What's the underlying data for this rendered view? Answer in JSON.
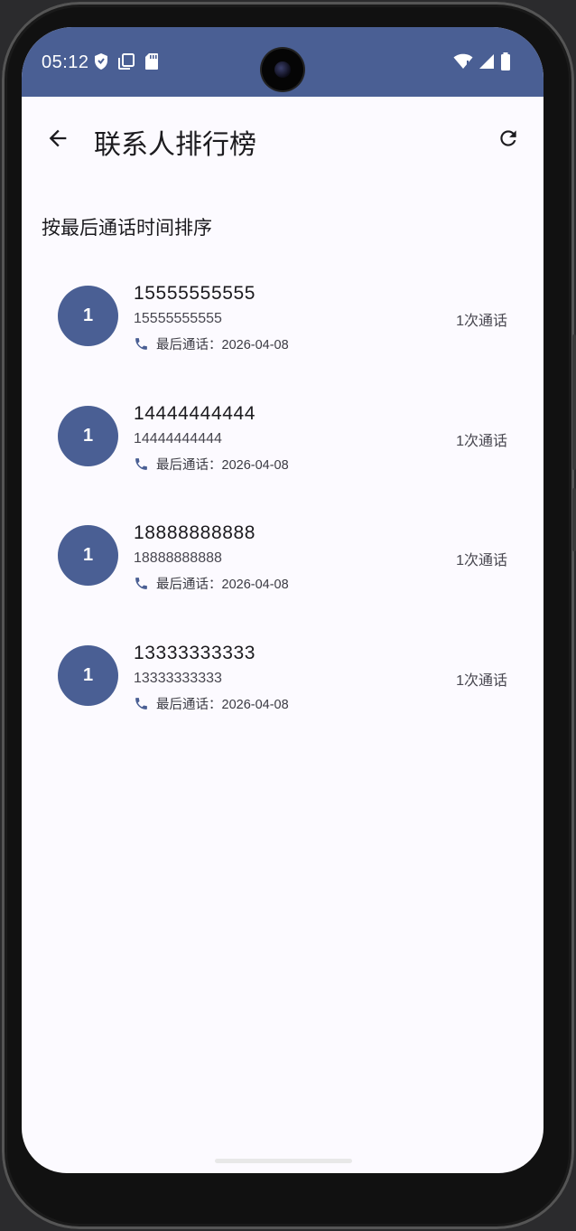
{
  "status_bar": {
    "time": "05:12",
    "left_icons": [
      "shield-icon",
      "copy-icon",
      "sd-card-icon"
    ],
    "right_icons": [
      "wifi-icon",
      "signal-icon",
      "battery-icon"
    ]
  },
  "app_bar": {
    "title": "联系人排行榜",
    "back_icon": "arrow-back-icon",
    "refresh_icon": "refresh-icon"
  },
  "section_title": "按最后通话时间排序",
  "contacts": [
    {
      "rank": "1",
      "name": "15555555555",
      "number": "15555555555",
      "last_call": "最后通话：2026-04-08",
      "count": "1次通话"
    },
    {
      "rank": "1",
      "name": "14444444444",
      "number": "14444444444",
      "last_call": "最后通话：2026-04-08",
      "count": "1次通话"
    },
    {
      "rank": "1",
      "name": "18888888888",
      "number": "18888888888",
      "last_call": "最后通话：2026-04-08",
      "count": "1次通话"
    },
    {
      "rank": "1",
      "name": "13333333333",
      "number": "13333333333",
      "last_call": "最后通话：2026-04-08",
      "count": "1次通话"
    }
  ],
  "colors": {
    "primary": "#4a5f94",
    "background": "#fcfaff",
    "text": "#1c1b1f"
  }
}
